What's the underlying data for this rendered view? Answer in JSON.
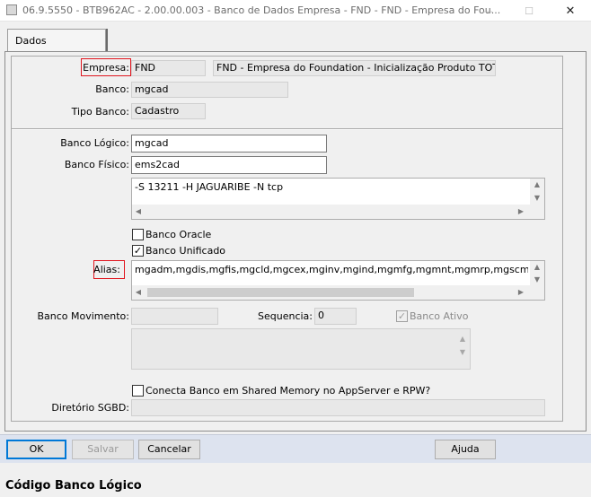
{
  "window": {
    "title": "06.9.5550 - BTB962AC - 2.00.00.003 - Banco de Dados Empresa - FND - FND - Empresa do Fou...",
    "minimize_glyph": "—",
    "maximize_glyph": "☐",
    "close_glyph": "✕"
  },
  "tabs": [
    {
      "label": "Dados",
      "active": true
    }
  ],
  "form": {
    "empresa_label": "Empresa:",
    "empresa_code": "FND",
    "empresa_name": "FND - Empresa do Foundation - Inicialização Produto TOTVS",
    "banco_label": "Banco:",
    "banco_value": "mgcad",
    "tipo_banco_label": "Tipo Banco:",
    "tipo_banco_value": "Cadastro",
    "banco_logico_label": "Banco Lógico:",
    "banco_logico_value": "mgcad",
    "banco_fisico_label": "Banco Físico:",
    "banco_fisico_value": "ems2cad",
    "parametros_value": "-S 13211 -H JAGUARIBE -N tcp",
    "banco_oracle_label": "Banco Oracle",
    "banco_oracle_checked": false,
    "banco_unificado_label": "Banco Unificado",
    "banco_unificado_checked": true,
    "alias_label": "Alias:",
    "alias_value": "mgadm,mgdis,mgfis,mgcld,mgcex,mginv,mgind,mgmfg,mgmnt,mgmrp,mgscm,mgfro,mgdbr,ems",
    "banco_movimento_label": "Banco Movimento:",
    "banco_movimento_value": "",
    "sequencia_label": "Sequencia:",
    "sequencia_value": "0",
    "banco_ativo_label": "Banco Ativo",
    "banco_ativo_checked": true,
    "shared_memory_label": "Conecta Banco em Shared Memory no AppServer e RPW?",
    "shared_memory_checked": false,
    "diretorio_label": "Diretório SGBD:",
    "diretorio_value": ""
  },
  "buttons": {
    "ok": "OK",
    "salvar": "Salvar",
    "cancelar": "Cancelar",
    "ajuda": "Ajuda"
  },
  "status_bar": {
    "text": "Código Banco Lógico"
  },
  "colors": {
    "highlight_box": "#e0151e",
    "button_bar": "#dde3ef",
    "focus_border": "#0078d7"
  }
}
